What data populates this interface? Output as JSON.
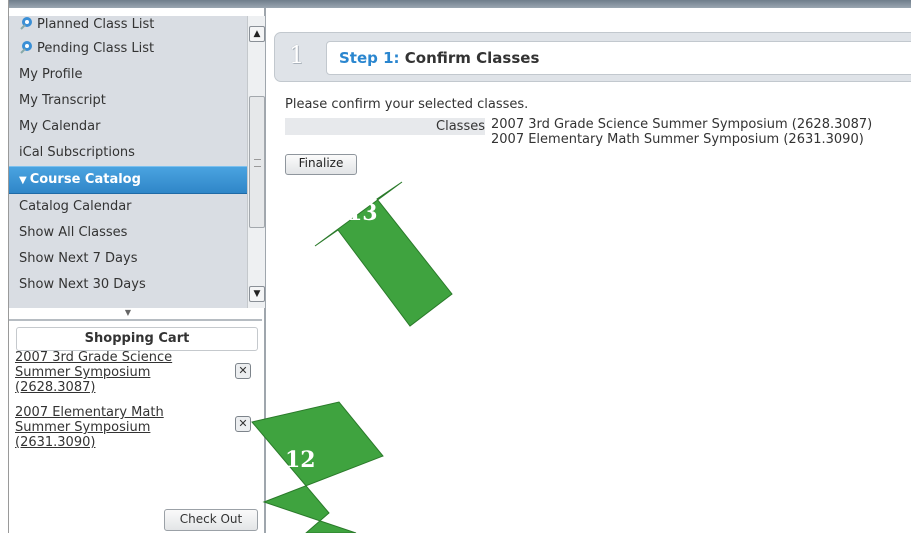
{
  "nav": {
    "items": [
      {
        "label": "Planned Class List",
        "icon": "pin-icon"
      },
      {
        "label": "Pending Class List",
        "icon": "pin-icon"
      },
      {
        "label": "My Profile"
      },
      {
        "label": "My Transcript"
      },
      {
        "label": "My Calendar"
      },
      {
        "label": "iCal Subscriptions"
      },
      {
        "label": "Course Catalog",
        "active": true,
        "icon": "triangle-down-icon"
      },
      {
        "label": "Catalog Calendar"
      },
      {
        "label": "Show All Classes"
      },
      {
        "label": "Show Next 7 Days"
      },
      {
        "label": "Show Next 30 Days"
      }
    ]
  },
  "cart": {
    "title": "Shopping Cart",
    "items": [
      {
        "line1": "2007 3rd Grade Science",
        "line2": "Summer Symposium",
        "line3": "(2628.3087)"
      },
      {
        "line1": "2007 Elementary Math",
        "line2": "Summer Symposium",
        "line3": "(2631.3090)"
      }
    ],
    "checkout_label": "Check Out"
  },
  "step": {
    "number": "1",
    "lead": "Step 1:",
    "title": "Confirm Classes"
  },
  "main": {
    "confirm_text": "Please confirm your selected classes.",
    "classes_label": "Classes",
    "classes": [
      "2007 3rd Grade Science Summer Symposium (2628.3087)",
      "2007 Elementary Math Summer Symposium (2631.3090)"
    ],
    "finalize_label": "Finalize"
  },
  "annotations": {
    "arrow_13": "13",
    "arrow_12": "12",
    "color": "#3fa33f"
  }
}
